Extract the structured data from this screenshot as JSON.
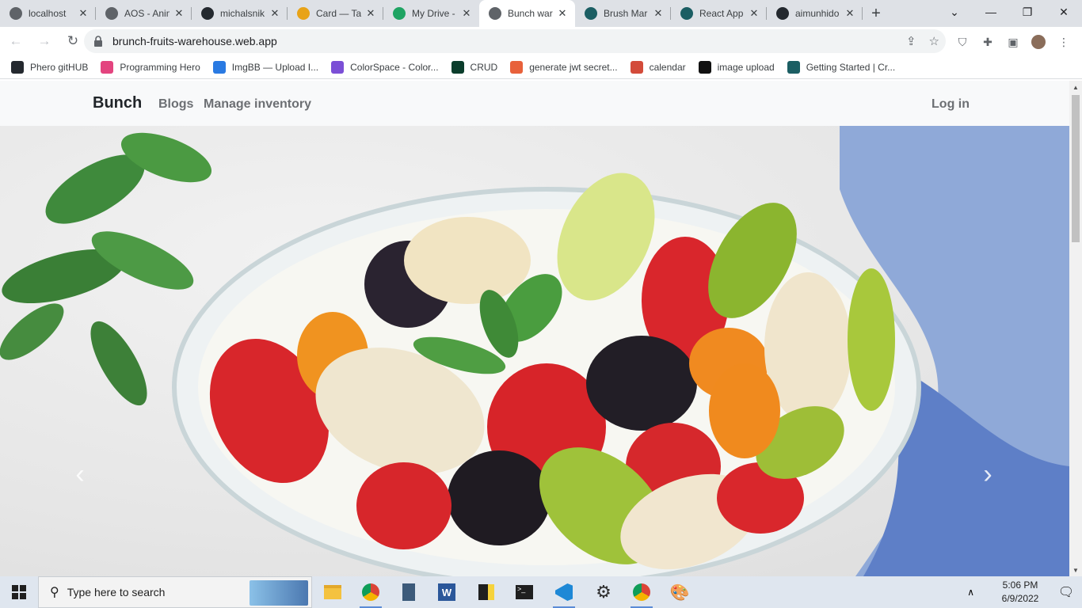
{
  "tabs": [
    {
      "title": "localhost",
      "icon": "react-icon",
      "color": "#5f6368"
    },
    {
      "title": "AOS - Anim",
      "icon": "globe-icon",
      "color": "#5f6368"
    },
    {
      "title": "michalsnik",
      "icon": "github-icon",
      "color": "#24292f"
    },
    {
      "title": "Card — Ta",
      "icon": "tailwind-icon",
      "color": "#e8a317"
    },
    {
      "title": "My Drive -",
      "icon": "google-drive-icon",
      "color": "#1fa463"
    },
    {
      "title": "Bunch war",
      "icon": "globe-icon",
      "color": "#5f6368",
      "active": true
    },
    {
      "title": "Brush Mar",
      "icon": "react-icon",
      "color": "#1b5e63"
    },
    {
      "title": "React App",
      "icon": "react-icon",
      "color": "#1b5e63"
    },
    {
      "title": "aimunhido",
      "icon": "github-icon",
      "color": "#24292f"
    }
  ],
  "address": {
    "url": "brunch-fruits-warehouse.web.app"
  },
  "bookmarks": [
    {
      "label": "Phero gitHUB",
      "icon": "github-icon",
      "color": "#24292f"
    },
    {
      "label": "Programming Hero",
      "icon": "programming-hero-icon",
      "color": "#e3447f"
    },
    {
      "label": "ImgBB — Upload I...",
      "icon": "imgbb-icon",
      "color": "#2a7ae2"
    },
    {
      "label": "ColorSpace - Color...",
      "icon": "colorspace-icon",
      "color": "#7b4fd6"
    },
    {
      "label": "CRUD",
      "icon": "mongodb-icon",
      "color": "#0b3d2c"
    },
    {
      "label": "generate jwt secret...",
      "icon": "jwt-icon",
      "color": "#e8613b"
    },
    {
      "label": "calendar",
      "icon": "calendar-icon",
      "color": "#d34b3a"
    },
    {
      "label": "image upload",
      "icon": "medium-icon",
      "color": "#111111"
    },
    {
      "label": "Getting Started | Cr...",
      "icon": "react-icon",
      "color": "#1b5e63"
    }
  ],
  "site": {
    "brand": "Bunch",
    "nav": [
      "Blogs",
      "Manage inventory"
    ],
    "login": "Log in"
  },
  "taskbar": {
    "search_placeholder": "Type here to search",
    "time": "5:06 PM",
    "date": "6/9/2022"
  }
}
